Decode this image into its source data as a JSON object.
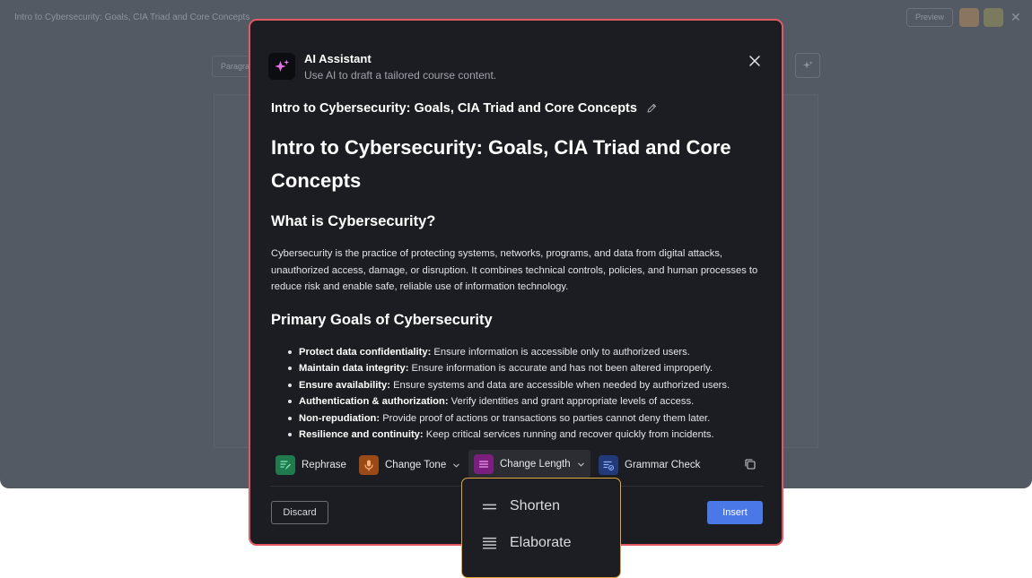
{
  "background": {
    "window_title": "Intro to Cybersecurity: Goals, CIA Triad and Core Concepts",
    "preview_label": "Preview",
    "toolbar_format": "Paragraph"
  },
  "modal": {
    "title": "AI Assistant",
    "subtitle": "Use AI to draft a tailored course content.",
    "doc_title": "Intro to Cybersecurity: Goals, CIA Triad and Core Concepts",
    "content": {
      "heading": "Intro to Cybersecurity: Goals, CIA Triad and Core Concepts",
      "section1_heading": "What is Cybersecurity?",
      "section1_para": "Cybersecurity is the practice of protecting systems, networks, programs, and data from digital attacks, unauthorized access, damage, or disruption. It combines technical controls, policies, and human processes to reduce risk and enable safe, reliable use of information technology.",
      "section2_heading": "Primary Goals of Cybersecurity",
      "goals": [
        {
          "term": "Protect data confidentiality:",
          "desc": " Ensure information is accessible only to authorized users."
        },
        {
          "term": "Maintain data integrity:",
          "desc": " Ensure information is accurate and has not been altered improperly."
        },
        {
          "term": "Ensure availability:",
          "desc": " Ensure systems and data are accessible when needed by authorized users."
        },
        {
          "term": "Authentication & authorization:",
          "desc": " Verify identities and grant appropriate levels of access."
        },
        {
          "term": "Non-repudiation:",
          "desc": " Provide proof of actions or transactions so parties cannot deny them later."
        },
        {
          "term": "Resilience and continuity:",
          "desc": " Keep critical services running and recover quickly from incidents."
        }
      ]
    },
    "actions": {
      "rephrase": "Rephrase",
      "change_tone": "Change Tone",
      "change_length": "Change Length",
      "grammar_check": "Grammar Check"
    },
    "discard_label": "Discard",
    "insert_label": "Insert"
  },
  "length_dropdown": {
    "shorten": "Shorten",
    "elaborate": "Elaborate"
  },
  "colors": {
    "rephrase_icon_bg": "#1f7a4e",
    "tone_icon_bg": "#9a4a16",
    "length_icon_bg": "#7a1f7d",
    "grammar_icon_bg": "#223a7a",
    "insert_bg": "#4a78e6",
    "modal_border": "#e05a60",
    "dropdown_border": "#e2a63a"
  }
}
